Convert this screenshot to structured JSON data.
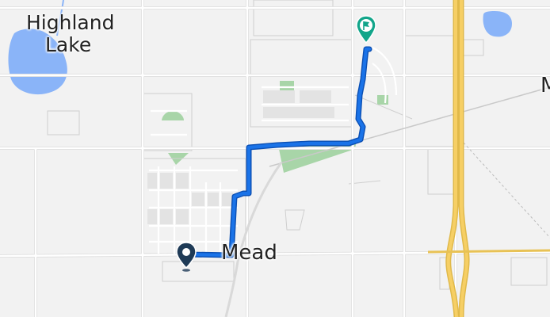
{
  "map": {
    "labels": {
      "highland_lake_line1": "Highland",
      "highland_lake_line2": "Lake",
      "mead": "Mead",
      "edge_partial": "M"
    },
    "colors": {
      "background": "#f2f2f2",
      "road": "#ffffff",
      "road_casing": "#d6d6d6",
      "water": "#8ab4f8",
      "park": "#a8d5a8",
      "highway": "#f6cf65",
      "route": "#1a73e8",
      "start_marker": "#1f3b57",
      "end_marker": "#12a58a"
    },
    "markers": {
      "start_icon": "location-pin-icon",
      "end_icon": "flag-pin-icon"
    }
  }
}
